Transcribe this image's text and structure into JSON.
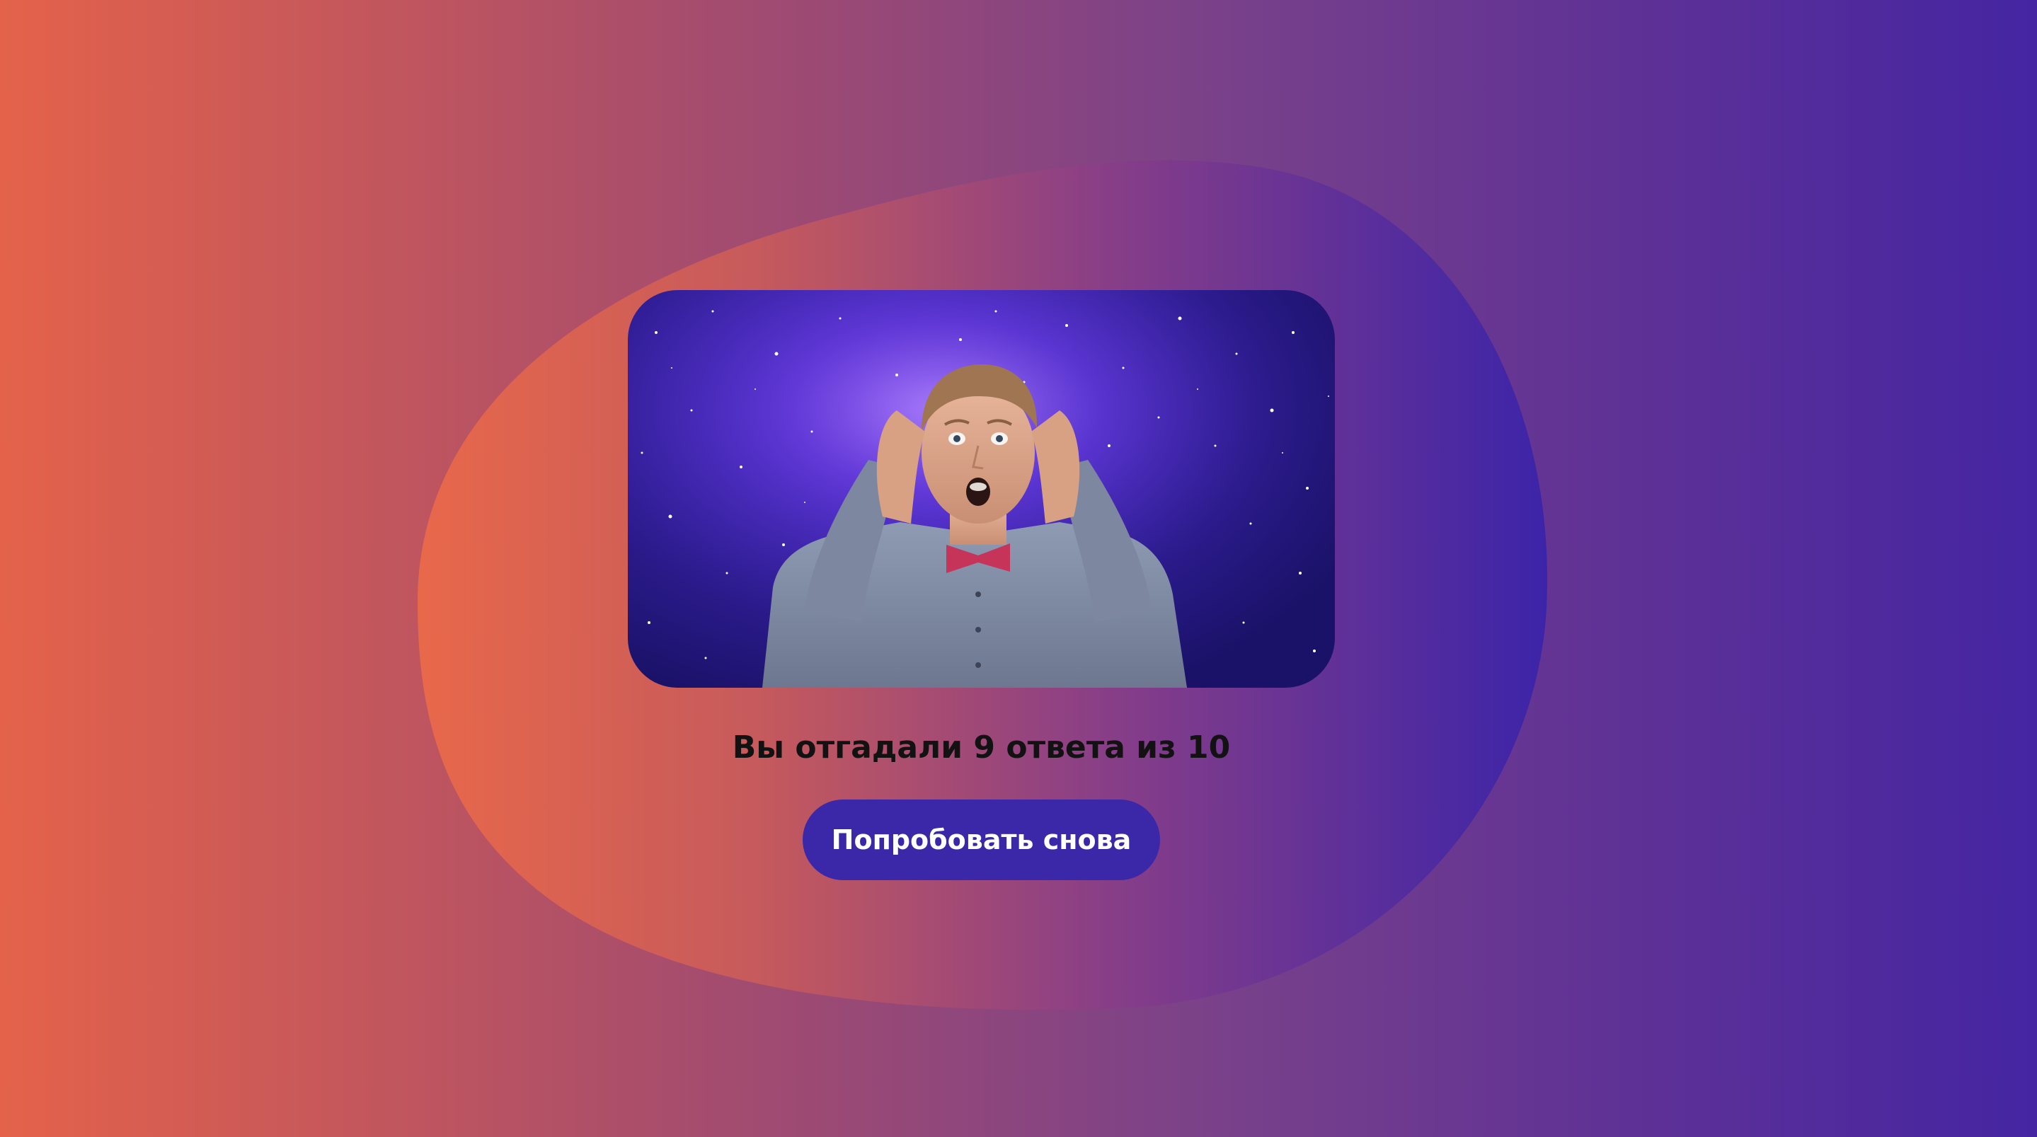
{
  "result": {
    "text": "Вы отгадали 9 ответа из 10"
  },
  "actions": {
    "retry_label": "Попробовать снова"
  },
  "image": {
    "icon": "surprised-man-space-image"
  },
  "colors": {
    "gradient_start": "#e4624a",
    "gradient_end": "#4525a2",
    "button": "#3a28a8",
    "button_text": "#ffffff",
    "text": "#121212"
  }
}
